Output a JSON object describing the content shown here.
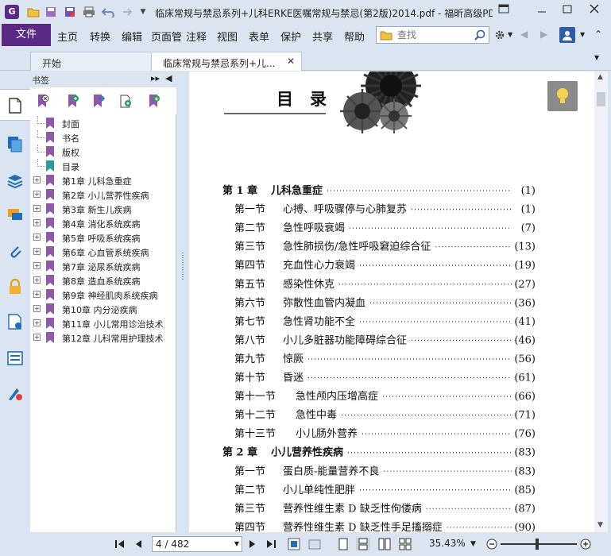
{
  "window": {
    "title": "临床常规与禁忌系列+儿科ERKE医嘱常规与禁忌(第2版)2014.pdf - 福昕高级PD...",
    "app_icon_letter": "G"
  },
  "menu": {
    "file": "文件",
    "items": [
      "主页",
      "转换",
      "编辑",
      "页面管",
      "注释",
      "视图",
      "表单",
      "保护",
      "共享",
      "帮助"
    ]
  },
  "search": {
    "placeholder": "查找"
  },
  "tabs": [
    {
      "label": "开始"
    },
    {
      "label": "临床常规与禁忌系列+儿..."
    }
  ],
  "bookmarks": {
    "title": "书签",
    "items": [
      {
        "label": "封面",
        "expandable": false,
        "color": "#8e5aa8"
      },
      {
        "label": "书名",
        "expandable": false,
        "color": "#8e5aa8"
      },
      {
        "label": "版权",
        "expandable": false,
        "color": "#8e5aa8"
      },
      {
        "label": "目录",
        "expandable": false,
        "color": "#2a9d8f"
      },
      {
        "label": "第1章 儿科急重症",
        "expandable": true,
        "color": "#8e5aa8"
      },
      {
        "label": "第2章 小儿营养性疾病",
        "expandable": true,
        "color": "#8e5aa8"
      },
      {
        "label": "第3章 新生儿疾病",
        "expandable": true,
        "color": "#8e5aa8"
      },
      {
        "label": "第4章 消化系统疾病",
        "expandable": true,
        "color": "#8e5aa8"
      },
      {
        "label": "第5章 呼吸系统疾病",
        "expandable": true,
        "color": "#8e5aa8"
      },
      {
        "label": "第6章 心血管系统疾病",
        "expandable": true,
        "color": "#8e5aa8"
      },
      {
        "label": "第7章 泌尿系统疾病",
        "expandable": true,
        "color": "#8e5aa8"
      },
      {
        "label": "第8章 造血系统疾病",
        "expandable": true,
        "color": "#8e5aa8"
      },
      {
        "label": "第9章 神经肌肉系统疾病",
        "expandable": true,
        "color": "#8e5aa8"
      },
      {
        "label": "第10章 内分泌疾病",
        "expandable": true,
        "color": "#8e5aa8"
      },
      {
        "label": "第11章 小儿常用诊治技术",
        "expandable": true,
        "color": "#8e5aa8"
      },
      {
        "label": "第12章 儿科常用护理技术",
        "expandable": true,
        "color": "#8e5aa8"
      }
    ]
  },
  "document": {
    "heading": "目　录",
    "entries": [
      {
        "chapter": true,
        "num": "第 1 章",
        "title": "儿科急重症",
        "page": "(1)"
      },
      {
        "chapter": false,
        "num": "第一节",
        "title": "心搏、呼吸骤停与心肺复苏",
        "page": "(1)"
      },
      {
        "chapter": false,
        "num": "第二节",
        "title": "急性呼吸衰竭",
        "page": "(7)"
      },
      {
        "chapter": false,
        "num": "第三节",
        "title": "急性肺损伤/急性呼吸窘迫综合征",
        "page": "(13)"
      },
      {
        "chapter": false,
        "num": "第四节",
        "title": "充血性心力衰竭",
        "page": "(19)"
      },
      {
        "chapter": false,
        "num": "第五节",
        "title": "感染性休克",
        "page": "(27)"
      },
      {
        "chapter": false,
        "num": "第六节",
        "title": "弥散性血管内凝血",
        "page": "(36)"
      },
      {
        "chapter": false,
        "num": "第七节",
        "title": "急性肾功能不全",
        "page": "(41)"
      },
      {
        "chapter": false,
        "num": "第八节",
        "title": "小儿多脏器功能障碍综合征",
        "page": "(46)"
      },
      {
        "chapter": false,
        "num": "第九节",
        "title": "惊厥",
        "page": "(56)"
      },
      {
        "chapter": false,
        "num": "第十节",
        "title": "昏迷",
        "page": "(61)"
      },
      {
        "chapter": false,
        "num": "第十一节",
        "title": "急性颅内压增高症",
        "page": "(66)"
      },
      {
        "chapter": false,
        "num": "第十二节",
        "title": "急性中毒",
        "page": "(71)"
      },
      {
        "chapter": false,
        "num": "第十三节",
        "title": "小儿肠外营养",
        "page": "(76)"
      },
      {
        "chapter": true,
        "num": "第 2 章",
        "title": "小儿营养性疾病",
        "page": "(83)"
      },
      {
        "chapter": false,
        "num": "第一节",
        "title": "蛋白质-能量营养不良",
        "page": "(83)"
      },
      {
        "chapter": false,
        "num": "第二节",
        "title": "小儿单纯性肥胖",
        "page": "(85)"
      },
      {
        "chapter": false,
        "num": "第三节",
        "title": "营养性维生素 D 缺乏性佝偻病",
        "page": "(87)"
      },
      {
        "chapter": false,
        "num": "第四节",
        "title": "营养性维生素 D 缺乏性手足搐搦症",
        "page": "(90)"
      }
    ]
  },
  "status": {
    "page_value": "4 / 482",
    "zoom": "35.43%"
  },
  "colors": {
    "accent": "#5b2a86",
    "chrome": "#dbe5f1",
    "bookmark_selected": "#2a9d8f"
  }
}
